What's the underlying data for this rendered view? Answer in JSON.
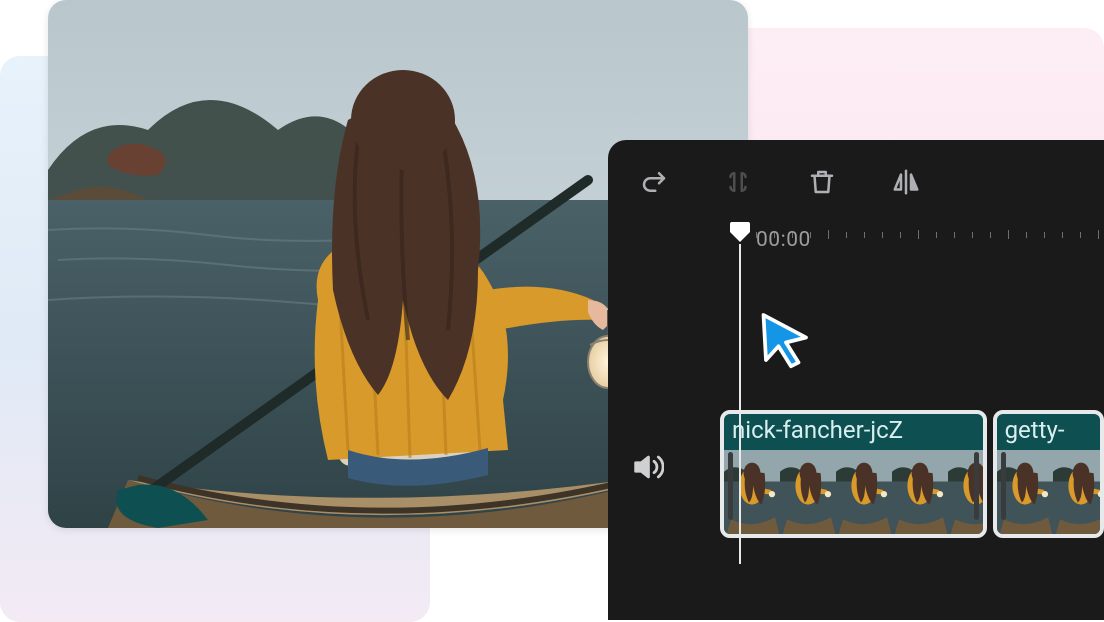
{
  "toolbar": {
    "redo_name": "redo",
    "split_name": "split",
    "delete_name": "delete",
    "flip_name": "flip-horizontal"
  },
  "timeline": {
    "playhead_time": "00:00"
  },
  "audio": {
    "icon_name": "speaker"
  },
  "clips": [
    {
      "label": "nick-fancher-jcZ"
    },
    {
      "label": "getty-"
    }
  ]
}
